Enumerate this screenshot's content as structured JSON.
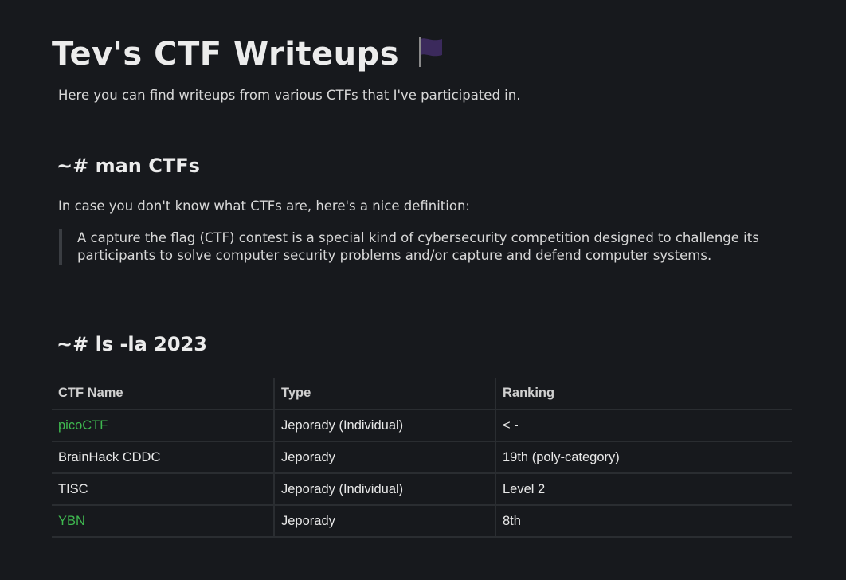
{
  "header": {
    "title": "Tev's CTF Writeups",
    "flag_icon": "black-flag-icon",
    "flag_color": "#3b2a5c",
    "intro": "Here you can find writeups from various CTFs that I've participated in."
  },
  "section_man": {
    "heading": "~# man CTFs",
    "lead": "In case you don't know what CTFs are, here's a nice definition:",
    "quote": "A capture the flag (CTF) contest is a special kind of cybersecurity competition designed to challenge its participants to solve computer security problems and/or capture and defend computer systems."
  },
  "section_ls": {
    "heading": "~# ls -la 2023",
    "table": {
      "columns": [
        "CTF Name",
        "Type",
        "Ranking"
      ],
      "rows": [
        {
          "name": "picoCTF",
          "link": true,
          "type": "Jeporady (Individual)",
          "ranking": "< -"
        },
        {
          "name": "BrainHack CDDC",
          "link": false,
          "type": "Jeporady",
          "ranking": "19th (poly-category)"
        },
        {
          "name": "TISC",
          "link": false,
          "type": "Jeporady (Individual)",
          "ranking": "Level 2"
        },
        {
          "name": "YBN",
          "link": true,
          "type": "Jeporady",
          "ranking": "8th"
        }
      ]
    }
  },
  "colors": {
    "background": "#17191d",
    "link": "#3fb950"
  }
}
